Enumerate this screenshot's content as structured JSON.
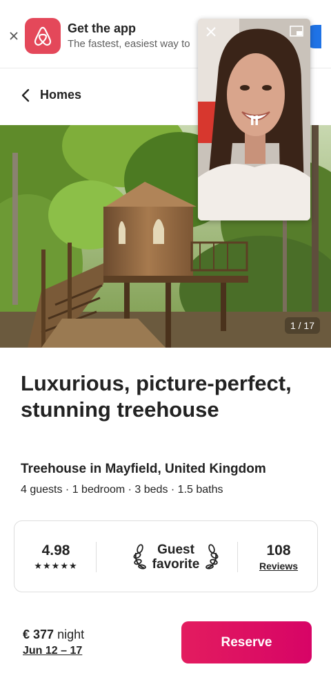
{
  "banner": {
    "title": "Get the app",
    "subtitle": "The fastest, easiest way to",
    "logo_icon": "airbnb-logo",
    "brand_color": "#e4485a"
  },
  "nav": {
    "back_label": "Homes"
  },
  "hero": {
    "photo_counter": "1 / 17"
  },
  "listing": {
    "title": "Luxurious, picture-perfect, stunning treehouse",
    "subtitle": "Treehouse in Mayfield, United Kingdom",
    "details": "4 guests · 1 bedroom · 3 beds · 1.5 baths"
  },
  "rating": {
    "score": "4.98",
    "stars": "★★★★★",
    "badge_line1": "Guest",
    "badge_line2": "favorite",
    "review_count": "108",
    "review_label": "Reviews"
  },
  "footer": {
    "price": "€ 377",
    "price_unit": "night",
    "dates": "Jun 12 – 17",
    "reserve_label": "Reserve",
    "accent_color": "#e31c5f"
  }
}
